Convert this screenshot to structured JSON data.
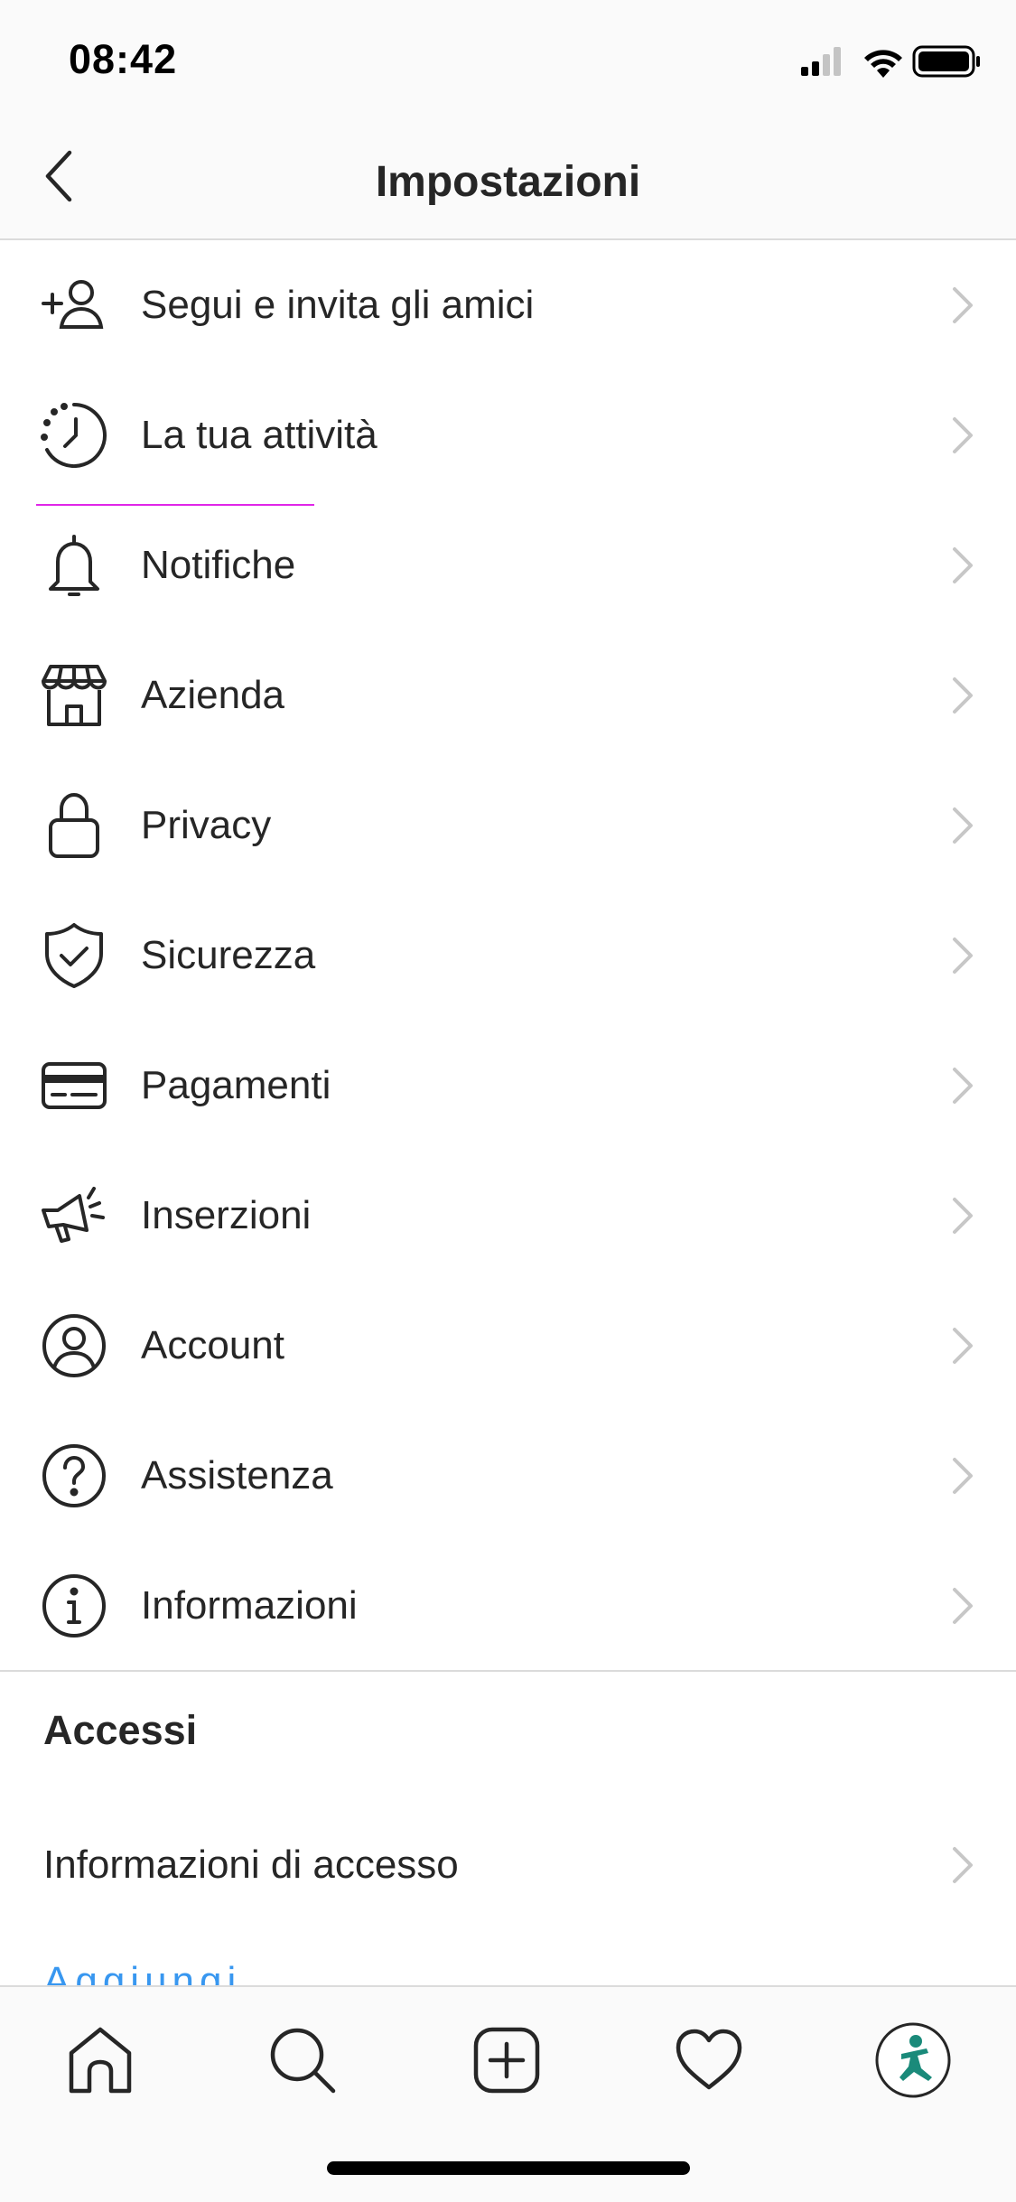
{
  "status_bar": {
    "time": "08:42"
  },
  "header": {
    "title": "Impostazioni"
  },
  "menu": {
    "items": [
      {
        "label": "Segui e invita gli amici",
        "icon": "add-person-icon"
      },
      {
        "label": "La tua attività",
        "icon": "activity-clock-icon"
      },
      {
        "label": "Notifiche",
        "icon": "bell-icon"
      },
      {
        "label": "Azienda",
        "icon": "storefront-icon"
      },
      {
        "label": "Privacy",
        "icon": "lock-icon"
      },
      {
        "label": "Sicurezza",
        "icon": "shield-check-icon"
      },
      {
        "label": "Pagamenti",
        "icon": "credit-card-icon"
      },
      {
        "label": "Inserzioni",
        "icon": "megaphone-icon"
      },
      {
        "label": "Account",
        "icon": "account-circle-icon"
      },
      {
        "label": "Assistenza",
        "icon": "help-circle-icon"
      },
      {
        "label": "Informazioni",
        "icon": "info-circle-icon"
      }
    ]
  },
  "access_section": {
    "title": "Accessi",
    "items": [
      {
        "label": "Informazioni di accesso"
      }
    ],
    "peek_link": "Aggiungi account"
  },
  "tab_bar": {
    "tabs": [
      {
        "icon": "home-icon"
      },
      {
        "icon": "search-icon"
      },
      {
        "icon": "new-post-icon"
      },
      {
        "icon": "heart-icon"
      },
      {
        "icon": "profile-avatar"
      }
    ]
  },
  "colors": {
    "text": "#262626",
    "chevron": "#c7c7c7",
    "divider": "#dbdbdb",
    "accent_link": "#3897f0",
    "highlight_underline": "#e026e8",
    "avatar_figure": "#1a8a7a"
  }
}
